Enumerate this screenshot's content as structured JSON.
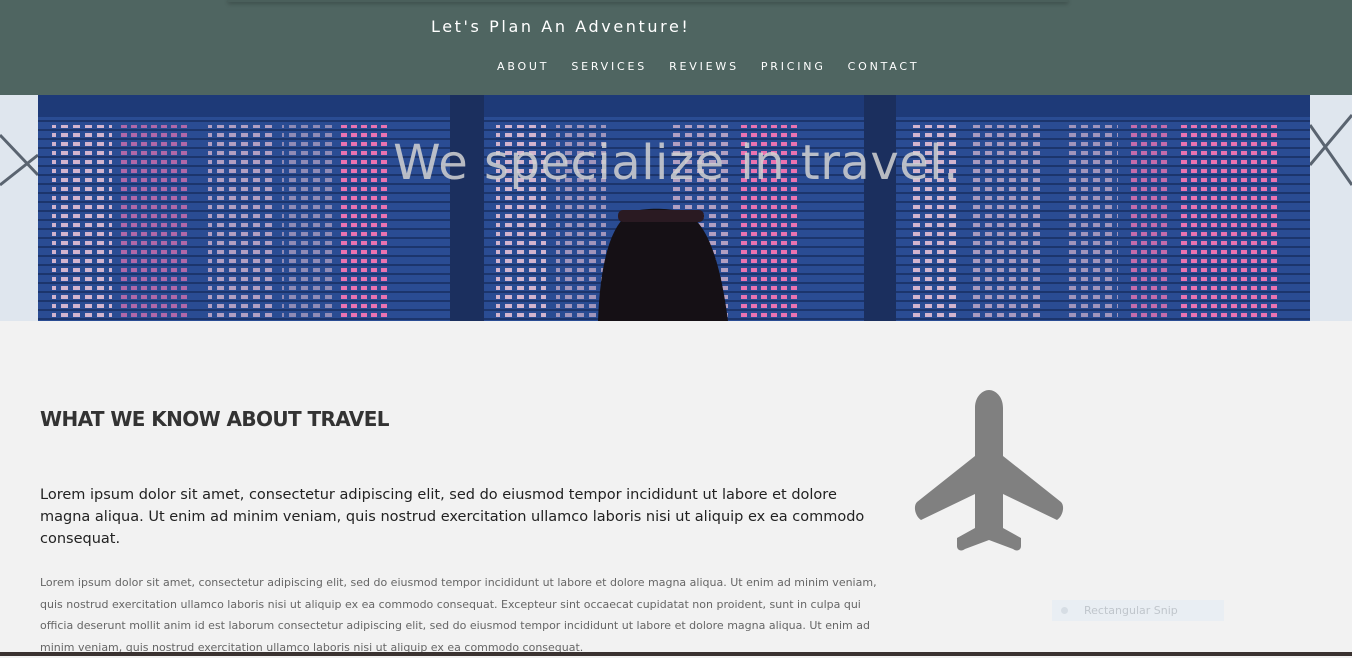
{
  "header": {
    "site_title": "Let's Plan An Adventure!",
    "nav": [
      "ABOUT",
      "SERVICES",
      "REVIEWS",
      "PRICING",
      "CONTACT"
    ]
  },
  "hero": {
    "headline": "We specialize in travel."
  },
  "main": {
    "section_title": "WHAT WE KNOW ABOUT TRAVEL",
    "lead": "Lorem ipsum dolor sit amet, consectetur adipiscing elit, sed do eiusmod tempor incididunt ut labore et dolore magna aliqua. Ut enim ad minim veniam, quis nostrud exercitation ullamco laboris nisi ut aliquip ex ea commodo consequat.",
    "body": "Lorem ipsum dolor sit amet, consectetur adipiscing elit, sed do eiusmod tempor incididunt ut labore et dolore magna aliqua. Ut enim ad minim veniam, quis nostrud exercitation ullamco laboris nisi ut aliquip ex ea commodo consequat. Excepteur sint occaecat cupidatat non proident, sunt in culpa qui officia deserunt mollit anim id est laborum consectetur adipiscing elit, sed do eiusmod tempor incididunt ut labore et dolore magna aliqua. Ut enim ad minim veniam, quis nostrud exercitation ullamco laboris nisi ut aliquip ex ea commodo consequat."
  },
  "overlay": {
    "snip_label": "Rectangular Snip"
  },
  "icons": {
    "feature": "airplane-icon"
  },
  "colors": {
    "header_bg": "#4f6561",
    "page_bg": "#f2f2f2",
    "icon_gray": "#808080"
  }
}
